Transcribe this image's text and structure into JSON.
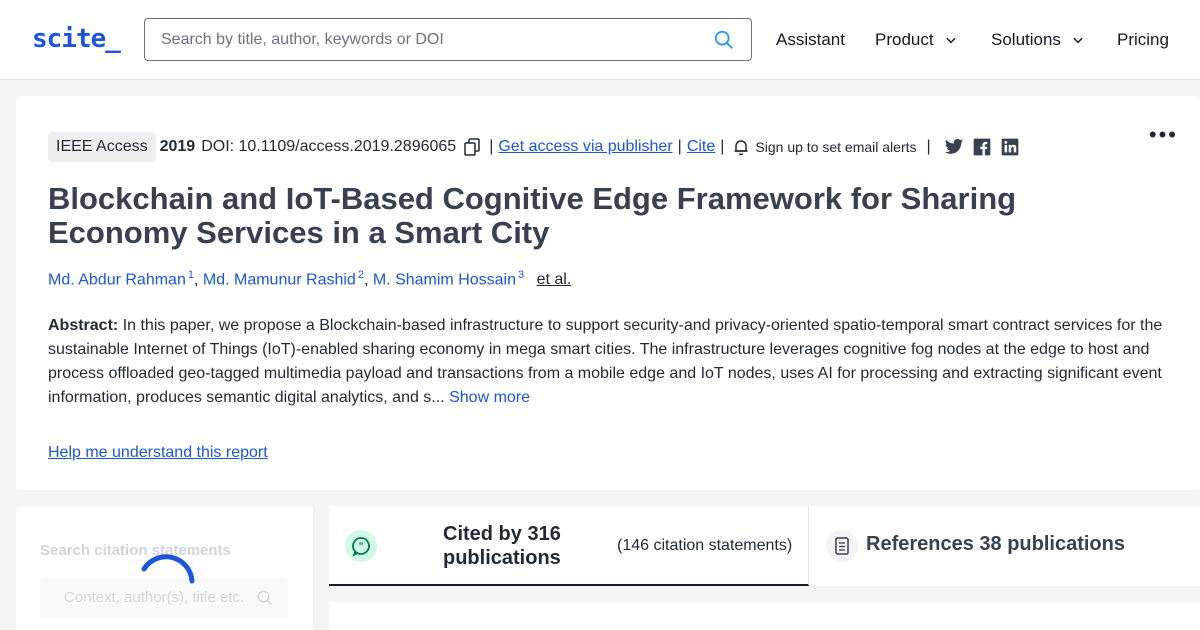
{
  "header": {
    "logo": "scite_",
    "search_placeholder": "Search by title, author, keywords or DOI",
    "nav": [
      "Assistant",
      "Product",
      "Solutions",
      "Pricing"
    ]
  },
  "paper": {
    "journal": "IEEE Access",
    "year": "2019",
    "doi": "DOI: 10.1109/access.2019.2896065",
    "get_access": "Get access via publisher",
    "cite": "Cite",
    "alerts": "Sign up to set email alerts",
    "title": "Blockchain and IoT-Based Cognitive Edge Framework for Sharing Economy Services in a Smart City",
    "authors": [
      {
        "name": "Md. Abdur Rahman",
        "sup": "1"
      },
      {
        "name": "Md. Mamunur Rashid",
        "sup": "2"
      },
      {
        "name": "M. Shamim Hossain",
        "sup": "3"
      }
    ],
    "et_al": "et al.",
    "abstract_label": "Abstract:",
    "abstract_text": "In this paper, we propose a Blockchain-based infrastructure to support security-and privacy-oriented spatio-temporal smart contract services for the sustainable Internet of Things (IoT)-enabled sharing economy in mega smart cities. The infrastructure leverages cognitive fog nodes at the edge to host and process offloaded geo-tagged multimedia payload and transactions from a mobile edge and IoT nodes, uses AI for processing and extracting significant event information, produces semantic digital analytics, and s...",
    "show_more": "Show more",
    "help_link": "Help me understand this report"
  },
  "citations_panel": {
    "label": "Search citation statements",
    "placeholder": "Context, author(s), title etc."
  },
  "tabs": {
    "cited_label": "Cited by 316 publications",
    "cited_sub": "(146 citation statements)",
    "refs_label": "References 38 publications"
  },
  "colors": {
    "link": "#1a56db",
    "brand": "#1a56db"
  }
}
